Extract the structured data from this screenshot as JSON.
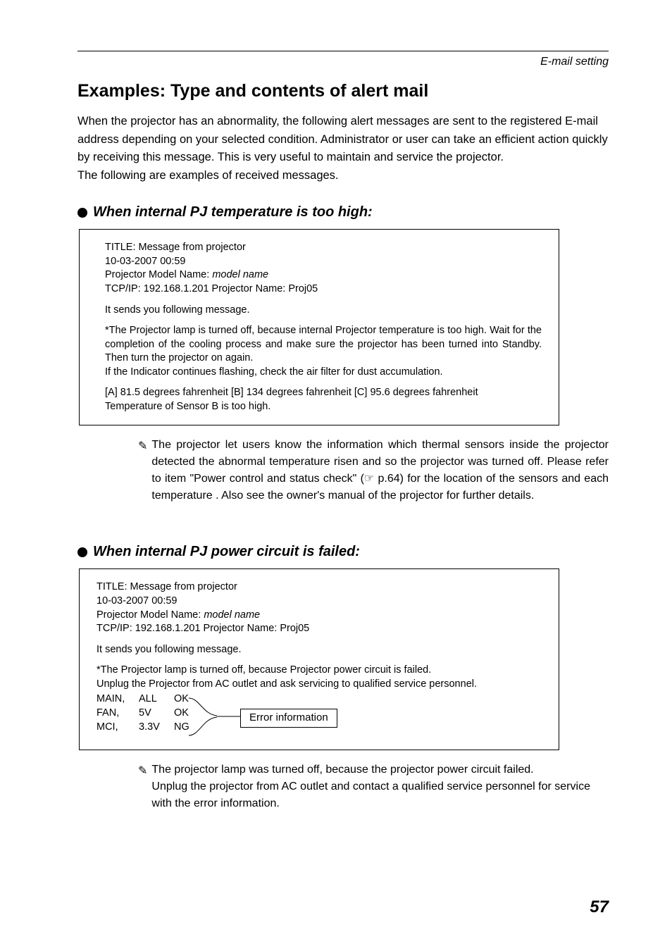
{
  "header_right": "E-mail setting",
  "title": "Examples: Type and contents of alert mail",
  "intro": "When the projector has an abnormality, the following alert messages are sent to the registered E-mail address depending on your selected condition. Administrator or user can take an efficient action quickly by receiving this message. This is very useful to maintain and service the projector.\nThe following are examples of received messages.",
  "section1": {
    "heading": "When internal PJ temperature is too high:",
    "box": {
      "title_line": "TITLE: Message from projector",
      "date_line": "10-03-2007 00:59",
      "model_prefix": "Projector Model Name: ",
      "model_name": "model name",
      "tcpip_line": "TCP/IP: 192.168.1.201 Projector Name: Proj05",
      "sends_line": "It sends you following message.",
      "msg1": "*The Projector lamp is turned off, because internal Projector temperature is too high. Wait for the completion of the cooling process and make sure the projector has been turned into Standby. Then turn the projector on again.",
      "msg2": " If the Indicator continues flashing, check the air filter for dust accumulation.",
      "temp_line": "[A] 81.5 degrees fahrenheit [B] 134 degrees fahrenheit  [C] 95.6 degrees fahrenheit",
      "temp_sensor": "Temperature of Sensor B is too high."
    },
    "note": "The projector let users know the information which thermal sensors inside the projector detected the abnormal temperature risen and so the projector was turned off. Please refer to item \"Power control and status check\" (☞ p.64) for the location of the sensors and each temperature . Also see the owner's manual of the projector for further details."
  },
  "section2": {
    "heading": "When internal PJ power circuit is failed:",
    "box": {
      "title_line": "TITLE: Message from projector",
      "date_line": "10-03-2007 00:59",
      "model_prefix": "Projector Model Name: ",
      "model_name": "model name",
      "tcpip_line": "TCP/IP: 192.168.1.201 Projector Name: Proj05",
      "sends_line": "It sends you following message.",
      "msg1": "*The Projector lamp is turned off, because Projector power circuit is failed.",
      "msg2": "Unplug the Projector from AC outlet and ask servicing to qualified service personnel.",
      "rows": [
        {
          "c0": "MAIN,",
          "c1": "ALL",
          "c2": "OK"
        },
        {
          "c0": "FAN,",
          "c1": "5V",
          "c2": "OK"
        },
        {
          "c0": "MCI,",
          "c1": "3.3V",
          "c2": "NG"
        }
      ],
      "callout": "Error information"
    },
    "note": "The projector lamp was turned off, because the projector power circuit failed.\nUnplug the projector from AC outlet and contact a qualified service personnel for service with the error information."
  },
  "page_number": "57"
}
